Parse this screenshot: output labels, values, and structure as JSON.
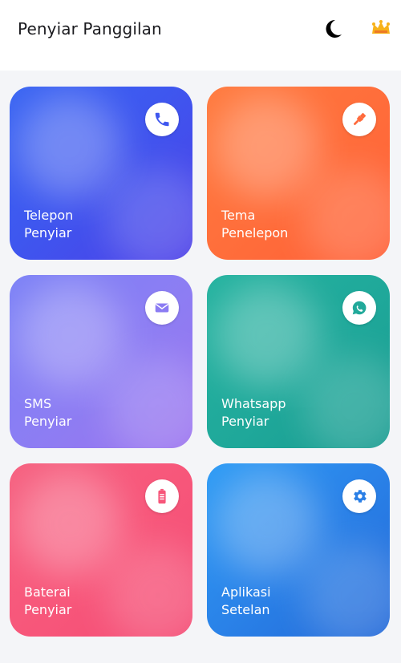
{
  "header": {
    "title": "Penyiar Panggilan",
    "icons": [
      "moon-icon",
      "crown-icon"
    ]
  },
  "tiles": [
    {
      "line1": "Telepon",
      "line2": "Penyiar",
      "icon": "phone-icon",
      "color": "#3f5ff0"
    },
    {
      "line1": "Tema",
      "line2": "Penelepon",
      "icon": "flashlight-icon",
      "color": "#ff6b3d"
    },
    {
      "line1": "SMS",
      "line2": "Penyiar",
      "icon": "mail-icon",
      "color": "#8b7cf3"
    },
    {
      "line1": "Whatsapp",
      "line2": "Penyiar",
      "icon": "whatsapp-icon",
      "color": "#21a99a"
    },
    {
      "line1": "Baterai",
      "line2": "Penyiar",
      "icon": "battery-icon",
      "color": "#f7567a"
    },
    {
      "line1": "Aplikasi",
      "line2": "Setelan",
      "icon": "gear-icon",
      "color": "#2a7fe6"
    }
  ]
}
